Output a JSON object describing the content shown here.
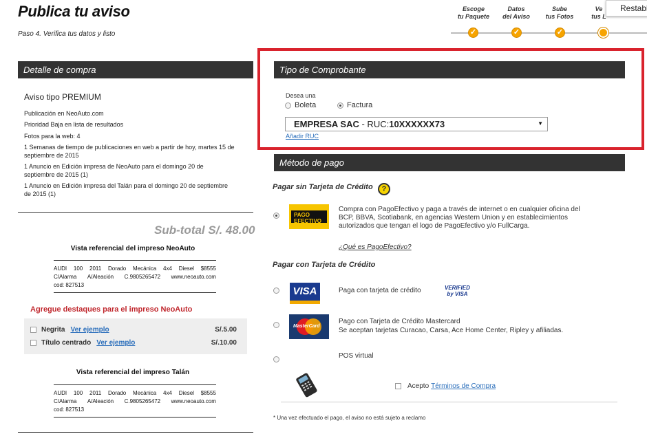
{
  "header": {
    "title": "Publica tu aviso",
    "subtitle": "Paso 4. Verifica tus datos y listo",
    "restab_label": "Restabl"
  },
  "steps": [
    {
      "label": "Escoge\ntu Paquete",
      "done": true
    },
    {
      "label": "Datos\ndel Aviso",
      "done": true
    },
    {
      "label": "Sube\ntus Fotos",
      "done": true
    },
    {
      "label": "Ve\ntus L",
      "done": false
    }
  ],
  "detalle": {
    "bar_title": "Detalle de compra",
    "aviso_tipo": "Aviso tipo PREMIUM",
    "lines": [
      "Publicación en NeoAuto.com",
      "Prioridad Baja en lista de resultados",
      "Fotos para la web: 4",
      "1 Semanas de tiempo de publicaciones en web a partir de hoy, martes 15 de septiembre de 2015",
      "1 Anuncio en Edición impresa de NeoAuto para el domingo 20 de septiembre de 2015 (1)",
      "1 Anuncio en Edición impresa del Talán para el domingo 20 de septiembre de 2015 (1)"
    ],
    "subtotal": "Sub-total S/. 48.00"
  },
  "vista_neoauto": {
    "title": "Vista referencial del impreso NeoAuto",
    "row1": [
      "AUDI",
      "100",
      "2011",
      "Dorado",
      "Mecánica",
      "4x4",
      "Diesel",
      "$8555"
    ],
    "row2": [
      "C/Alarma",
      "A/Aleación",
      "C.9805265472",
      "www.neoauto.com"
    ],
    "row3": "cod: 827513"
  },
  "destaques": {
    "title": "Agregue destaques para el impreso NeoAuto",
    "items": [
      {
        "label": "Negrita",
        "link": "Ver ejemplo",
        "price": "S/.5.00"
      },
      {
        "label": "Título centrado",
        "link": "Ver ejemplo",
        "price": "S/.10.00"
      }
    ]
  },
  "vista_talan": {
    "title": "Vista referencial del impreso Talán",
    "row1": [
      "AUDI",
      "100",
      "2011",
      "Dorado",
      "Mecánica",
      "4x4",
      "Diesel",
      "$8555"
    ],
    "row2": [
      "C/Alarma",
      "A/Aleación",
      "C.9805265472",
      "www.neoauto.com"
    ],
    "row3": "cod: 827513"
  },
  "comprobante": {
    "bar_title": "Tipo de Comprobante",
    "desea": "Desea una",
    "opt_boleta": "Boleta",
    "opt_factura": "Factura",
    "select_company": "EMPRESA SAC",
    "select_ruc_prefix": " - RUC:",
    "select_ruc": "10XXXXXX73",
    "add_ruc": "Añadir RUC"
  },
  "metodo": {
    "bar_title": "Método de pago",
    "sin_tarjeta_title": "Pagar sin Tarjeta de Crédito",
    "help_icon": "?",
    "pagoefectivo_logo": "PAGO EFECTIVO",
    "pagoefectivo_text": "Compra con PagoEfectivo y paga a través de internet o en cualquier oficina del BCP, BBVA, Scotiabank, en agencias Western Union y en establecimientos autorizados que tengan el logo de PagoEfectivo y/o FullCarga.",
    "pagoefectivo_link": "¿Qué es PagoEfectivo?",
    "con_tarjeta_title": "Pagar con Tarjeta de Crédito",
    "visa_logo": "VISA",
    "visa_text": "Paga con tarjeta de crédito",
    "verified_line1": "VERIFIED",
    "verified_line2": "by VISA",
    "mc_logo": "MasterCard",
    "mc_text1": "Pago con Tarjeta de Crédito Mastercard",
    "mc_text2": "Se aceptan tarjetas Curacao, Carsa, Ace Home Center, Ripley y afiliadas.",
    "pos_text": "POS virtual",
    "terms_prefix": "Acepto ",
    "terms_link": "Términos de Compra",
    "footnote": "* Una vez efectuado el pago, el aviso no está sujeto a reclamo"
  }
}
